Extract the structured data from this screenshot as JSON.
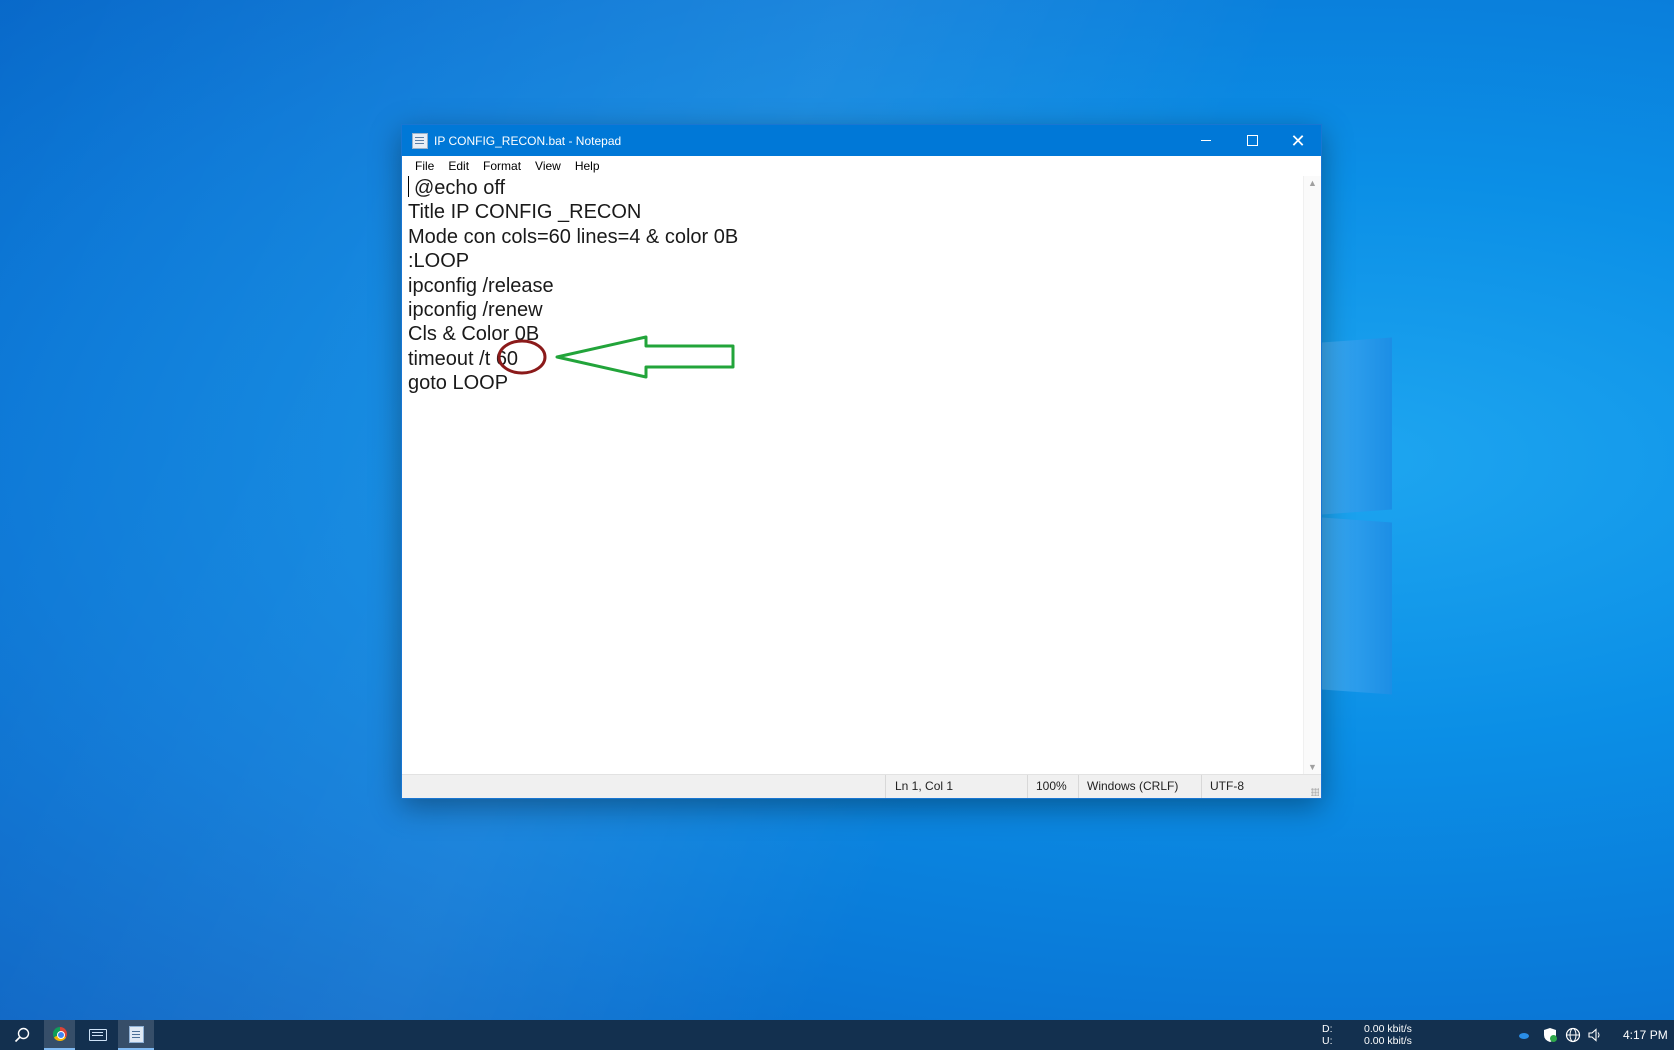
{
  "window": {
    "title": "IP CONFIG_RECON.bat - Notepad",
    "controls": {
      "minimize": "minimize",
      "maximize": "maximize",
      "close": "close"
    }
  },
  "menu": [
    "File",
    "Edit",
    "Format",
    "View",
    "Help"
  ],
  "editor": {
    "lines": [
      "@echo off",
      "Title IP CONFIG _RECON",
      "Mode con cols=60 lines=4 & color 0B",
      ":LOOP",
      "ipconfig /release",
      "ipconfig /renew",
      "Cls & Color 0B",
      "timeout /t 60",
      "goto LOOP"
    ]
  },
  "status": {
    "position": "Ln 1, Col 1",
    "zoom": "100%",
    "line_ending": "Windows (CRLF)",
    "encoding": "UTF-8"
  },
  "annotations": {
    "circle_color": "#8b1a1a",
    "arrow_color": "#22a43a"
  },
  "taskbar": {
    "icons": [
      "search-icon",
      "chrome-icon",
      "keyboard-icon",
      "notepad-icon"
    ],
    "network": {
      "down_label": "D:",
      "up_label": "U:",
      "down_value": "0.00 kbit/s",
      "up_value": "0.00 kbit/s"
    },
    "tray_icons": [
      "onedrive-icon",
      "security-icon",
      "network-globe-icon",
      "volume-icon"
    ],
    "clock": "4:17 PM"
  },
  "colors": {
    "titlebar": "#0078d7",
    "taskbar": "#13304f",
    "desktop": "#0b8fe6"
  }
}
